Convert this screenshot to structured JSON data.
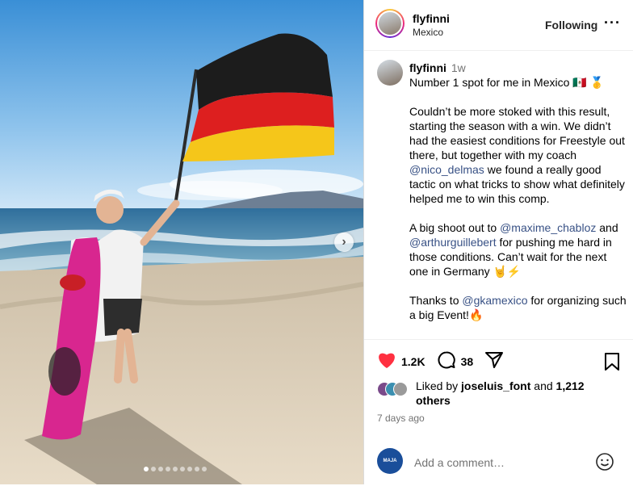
{
  "post": {
    "image_alt": "",
    "carousel_total": 9,
    "carousel_active": 1
  },
  "header": {
    "username": "flyfinni",
    "location": "Mexico",
    "follow_label": "Following",
    "more_label": "···"
  },
  "caption": {
    "username": "flyfinni",
    "time": "1w",
    "line1": "Number 1 spot for me in Mexico 🇲🇽 🥇",
    "para2_a": "Couldn’t be more stoked with this result, starting the season with a win. We didn’t had the easiest conditions for Freestyle out there, but together with my coach ",
    "mention_coach": "@nico_delmas",
    "para2_b": " we found a really good tactic on what tricks to show what definitely helped me to win this comp.",
    "para3_a": "A big shoot out to ",
    "mention_1": "@maxime_chabloz",
    "para3_b": " and ",
    "mention_2": "@arthurguillebert",
    "para3_c": " for pushing me hard in those conditions. Can’t wait for the next one in Germany 🤘⚡",
    "para4_a": "Thanks to ",
    "mention_3": "@gkamexico",
    "para4_b": " for organizing such a big Event!🔥"
  },
  "actions": {
    "like_count": "1.2K",
    "comment_count": "38",
    "liked_color": "#ff3040"
  },
  "likes": {
    "prefix": "Liked by ",
    "user": "joseluis_font",
    "middle": " and ",
    "count": "1,212",
    "suffix": "others"
  },
  "date": "7 days ago",
  "comment": {
    "placeholder": "Add a comment…",
    "avatar_text": "MAJA"
  }
}
